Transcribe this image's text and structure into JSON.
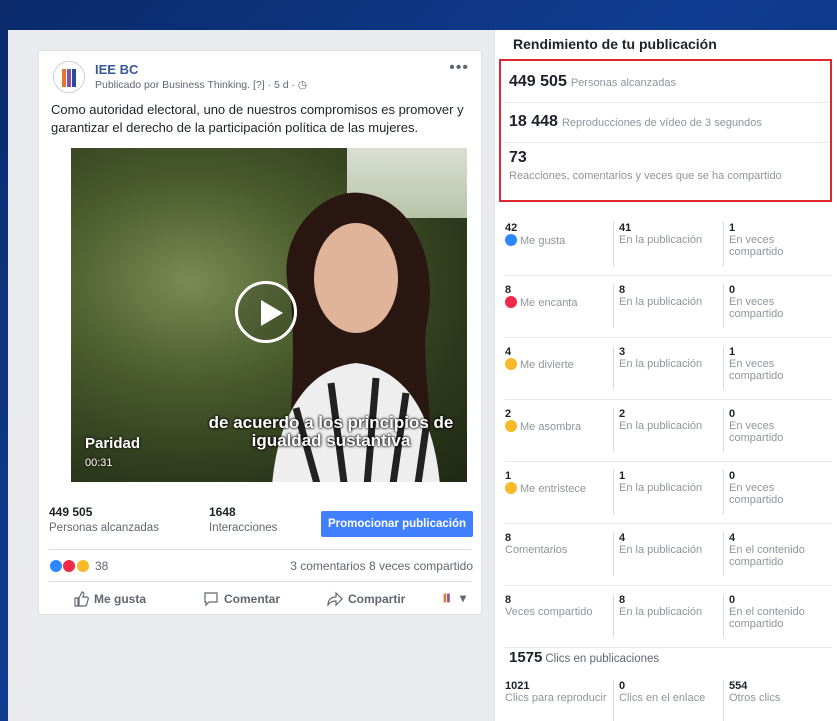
{
  "post": {
    "page_name": "IEE BC",
    "byline": "Publicado por Business Thinking. [?] · 5 d · ◷",
    "more": "•••",
    "text": "Como autoridad electoral, uno de nuestros compromisos es promover y garantizar el derecho de la participación política de las mujeres.",
    "video": {
      "caption": "de acuerdo a los principios de igualdad sustantiva",
      "title": "Paridad",
      "duration": "00:31"
    },
    "reach": {
      "value": "449 505",
      "label": "Personas alcanzadas"
    },
    "interactions": {
      "value": "1648",
      "label": "Interacciones"
    },
    "promote_label": "Promocionar publicación",
    "reaction_count": "38",
    "comments_shares": "3 comentarios 8 veces compartido",
    "actions": {
      "like": "Me gusta",
      "comment": "Comentar",
      "share": "Compartir",
      "page_selector": "▾"
    }
  },
  "panel": {
    "title": "Rendimiento de tu publicación",
    "reach": {
      "value": "449 505",
      "label": "Personas alcanzadas"
    },
    "views": {
      "value": "18 448",
      "label": "Reproducciones de vídeo de 3 segundos"
    },
    "engagement": {
      "value": "73",
      "label": "Reacciones, comentarios y veces que se ha compartido"
    },
    "breakdown": [
      {
        "total": "42",
        "label": "Me gusta",
        "icon": "like-icon",
        "color": "#2d88ff",
        "post": "41",
        "post_label": "En la publicación",
        "shared": "1",
        "shared_label": "En veces compartido"
      },
      {
        "total": "8",
        "label": "Me encanta",
        "icon": "love-icon",
        "color": "#f0284a",
        "post": "8",
        "post_label": "En la publicación",
        "shared": "0",
        "shared_label": "En veces compartido"
      },
      {
        "total": "4",
        "label": "Me divierte",
        "icon": "haha-icon",
        "color": "#f7b928",
        "post": "3",
        "post_label": "En la publicación",
        "shared": "1",
        "shared_label": "En veces compartido"
      },
      {
        "total": "2",
        "label": "Me asombra",
        "icon": "wow-icon",
        "color": "#f7b928",
        "post": "2",
        "post_label": "En la publicación",
        "shared": "0",
        "shared_label": "En veces compartido"
      },
      {
        "total": "1",
        "label": "Me entristece",
        "icon": "sad-icon",
        "color": "#f7b928",
        "post": "1",
        "post_label": "En la publicación",
        "shared": "0",
        "shared_label": "En veces compartido"
      },
      {
        "total": "8",
        "label": "Comentarios",
        "icon": "",
        "color": "",
        "post": "4",
        "post_label": "En la publicación",
        "shared": "4",
        "shared_label": "En el contenido compartido"
      },
      {
        "total": "8",
        "label": "Veces compartido",
        "icon": "",
        "color": "",
        "post": "8",
        "post_label": "En la publicación",
        "shared": "0",
        "shared_label": "En el contenido compartido"
      }
    ],
    "clicks": {
      "value": "1575",
      "label": "Clics en publicaciones",
      "items": [
        {
          "value": "1021",
          "label": "Clics para reproducir"
        },
        {
          "value": "0",
          "label": "Clics en el enlace"
        },
        {
          "value": "554",
          "label": "Otros clics"
        }
      ]
    }
  }
}
